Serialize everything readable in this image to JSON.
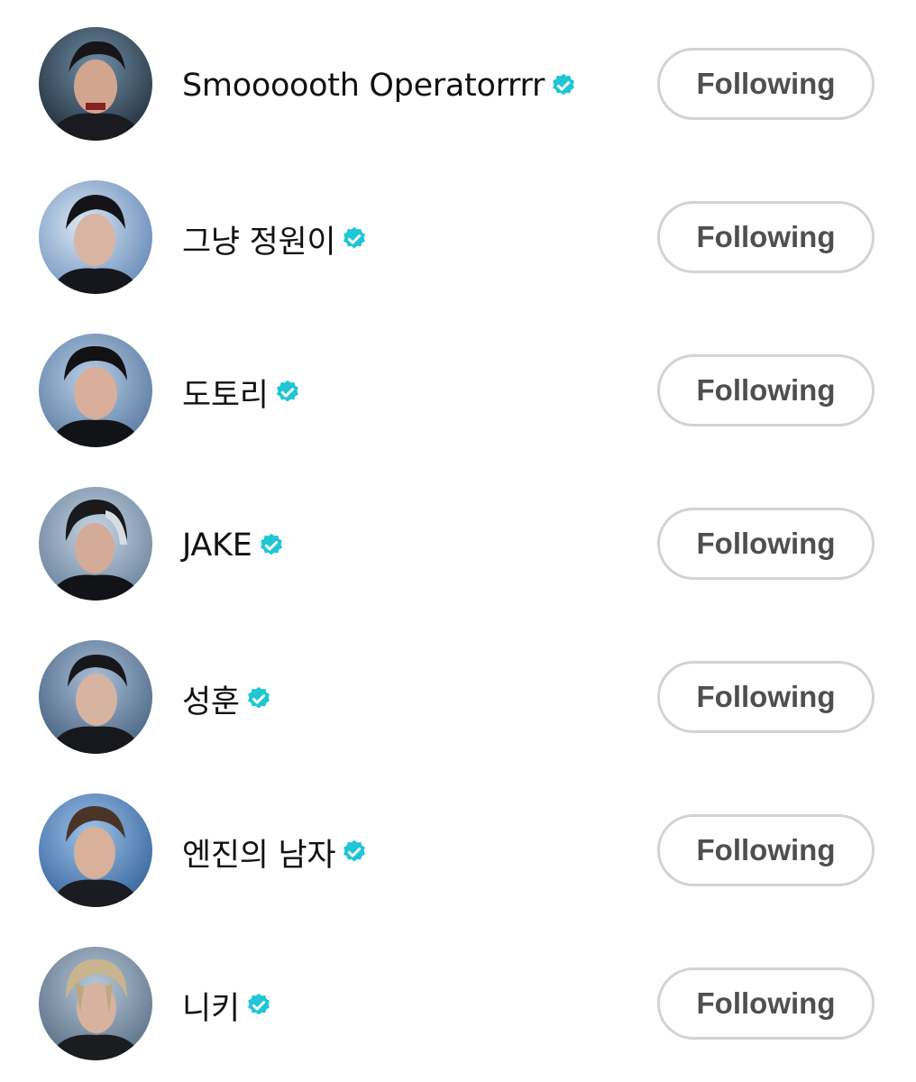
{
  "accent_color": "#1fc6d6",
  "users": [
    {
      "name": "Smoooooth Operatorrrr",
      "verified": true,
      "verified_icon": "verified-badge-icon",
      "button_label": "Following"
    },
    {
      "name": "그냥 정원이",
      "verified": true,
      "verified_icon": "verified-badge-icon",
      "button_label": "Following"
    },
    {
      "name": "도토리",
      "verified": true,
      "verified_icon": "verified-badge-icon",
      "button_label": "Following"
    },
    {
      "name": "JAKE",
      "verified": true,
      "verified_icon": "verified-badge-icon",
      "button_label": "Following"
    },
    {
      "name": "성훈",
      "verified": true,
      "verified_icon": "verified-badge-icon",
      "button_label": "Following"
    },
    {
      "name": "엔진의 남자",
      "verified": true,
      "verified_icon": "verified-badge-icon",
      "button_label": "Following"
    },
    {
      "name": "니키",
      "verified": true,
      "verified_icon": "verified-badge-icon",
      "button_label": "Following"
    }
  ]
}
